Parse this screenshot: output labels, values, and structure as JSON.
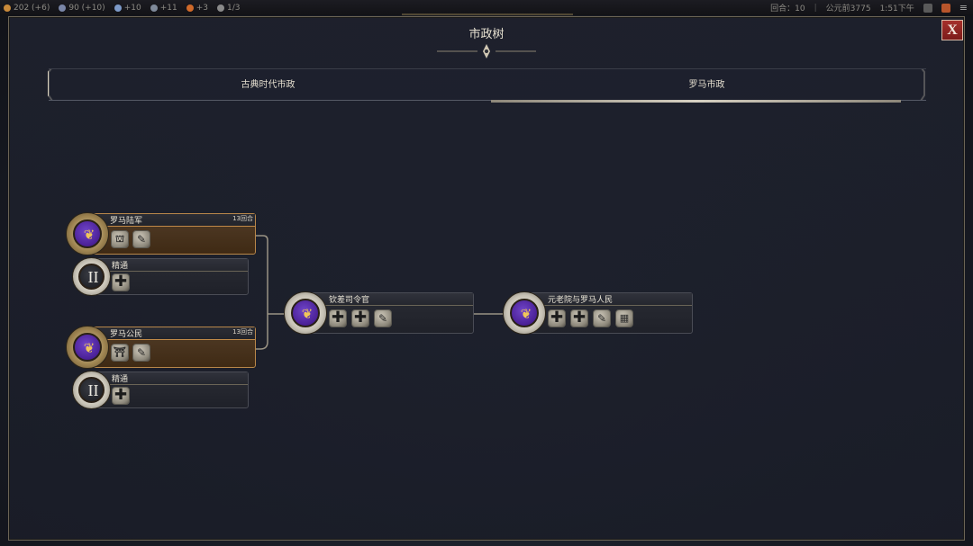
{
  "hud": {
    "resources": [
      {
        "icon": "science-icon",
        "text": "202  (+6)",
        "color": "#c98a3a"
      },
      {
        "icon": "culture-icon",
        "text": "90  (+10)",
        "color": "#7a86a8"
      },
      {
        "icon": "faith-icon",
        "text": "+10",
        "color": "#7d9ac8"
      },
      {
        "icon": "gold-icon",
        "text": "+11",
        "color": "#7f8a9a"
      },
      {
        "icon": "happiness-icon",
        "text": "+3",
        "color": "#d06a2a"
      },
      {
        "icon": "population-icon",
        "text": "1/3",
        "color": "#8a8a8a"
      }
    ],
    "turn": "回合：10",
    "era": "公元前3775",
    "time": "1:51下午"
  },
  "title": "市政树",
  "close_label": "X",
  "tabs": {
    "ancient": "古典时代市政",
    "roman": "罗马市政"
  },
  "nodes": {
    "roman_legion": {
      "name": "罗马陆军",
      "turns": "13回合"
    },
    "roman_legion_mastery": {
      "name": "精通",
      "roman": "II"
    },
    "roman_citizens": {
      "name": "罗马公民",
      "turns": "13回合"
    },
    "roman_citizens_mastery": {
      "name": "精通",
      "roman": "II"
    },
    "commander": {
      "name": "钦差司令官"
    },
    "senate": {
      "name": "元老院与罗马人民"
    }
  },
  "colors": {
    "panel_border": "#6b6455",
    "gold_accent": "#b8874a",
    "close_red": "#a5302b",
    "purple_medal": "#4a2096"
  }
}
